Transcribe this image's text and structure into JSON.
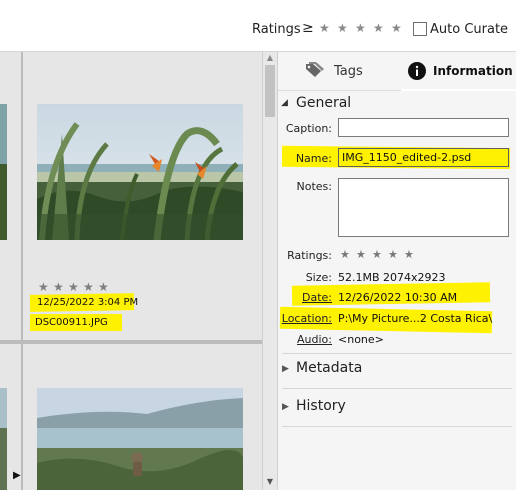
{
  "filter_bar": {
    "ratings_label": "Ratings",
    "ratings_operator": "≥",
    "star_glyph": "★",
    "auto_curate_label": "Auto Curate",
    "auto_curate_checked": false
  },
  "grid": {
    "items": [
      {
        "rating": 0,
        "date": "12/25/2022 3:04 PM",
        "filename": "DSC00911.JPG"
      }
    ],
    "expand_glyph": "▶"
  },
  "panel": {
    "tabs": [
      {
        "label": "Tags",
        "icon": "tag-icon"
      },
      {
        "label": "Information",
        "icon": "info-icon",
        "active": true
      }
    ],
    "general": {
      "title": "General",
      "caption_label": "Caption:",
      "caption_value": "",
      "name_label": "Name:",
      "name_value": "IMG_1150_edited-2.psd",
      "notes_label": "Notes:",
      "notes_value": "",
      "ratings_label": "Ratings:",
      "size_label": "Size:",
      "size_value": "52.1MB  2074x2923",
      "date_label": "Date:",
      "date_value": "12/26/2022 10:30 AM",
      "location_label": "Location:",
      "location_value": "P:\\My Picture...2 Costa Rica\\",
      "audio_label": "Audio:",
      "audio_value": "<none>"
    },
    "sections": [
      {
        "title": "Metadata",
        "expanded": false
      },
      {
        "title": "History",
        "expanded": false
      }
    ]
  },
  "colors": {
    "highlight": "#fff200",
    "panel_bg": "#f5f5f5",
    "grid_bg": "#d6d6d6"
  }
}
